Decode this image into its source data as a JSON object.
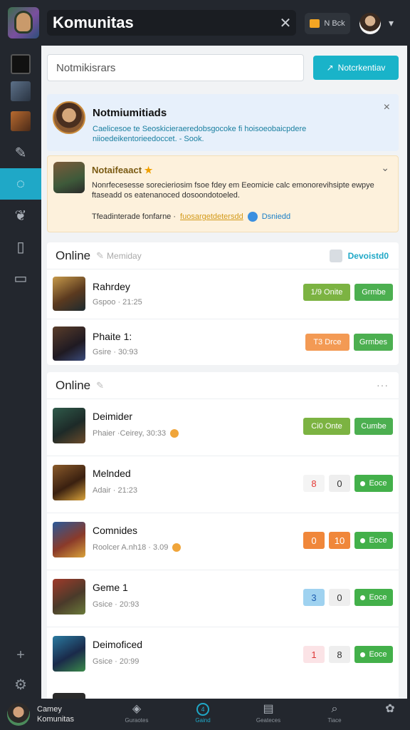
{
  "header": {
    "title": "Komunitas",
    "close_icon": "close-icon",
    "pill_text": "N Bck",
    "caret": "▾"
  },
  "rail": {
    "items": [
      {
        "name": "rail-thumb-1",
        "color": "#2b2b2b"
      },
      {
        "name": "rail-thumb-2",
        "color": "#4a5a6a"
      },
      {
        "name": "rail-thumb-3",
        "color": "#8a4a2a"
      },
      {
        "icon": "puzzle-icon",
        "glyph": "✎"
      },
      {
        "icon": "chat-icon",
        "glyph": "◌",
        "active": true
      },
      {
        "icon": "shield-icon",
        "glyph": "❦"
      },
      {
        "icon": "book-icon",
        "glyph": "▯"
      },
      {
        "icon": "message-icon",
        "glyph": "▭"
      }
    ],
    "bottom_icons": [
      {
        "icon": "add-icon",
        "glyph": "+"
      },
      {
        "icon": "settings-icon",
        "glyph": "⚙"
      }
    ]
  },
  "main": {
    "search_placeholder": "Notmikisrars",
    "primary_button": "Notcrkentiav",
    "notice": {
      "title": "Notmiumitiads",
      "text": "Caelicesoe te Seoskicieraeredobsgocoke fi hoisoeobaicpdere niioedeikentorieedoccet. - Sook.",
      "close": "×"
    },
    "alert": {
      "title": "Notaifeaact",
      "star": "★",
      "text": "Nonrfecesesse sorecieriosim fsoe fdey em Eeomicie calc emonorevihsipte ewpye ftaseadd os eatenanoced dosoondotoeled.",
      "footer_label": "Tfeadinterade fonfarne ·",
      "footer_link": "fuosargetdetersdd",
      "footer_link2": "Dsniedd",
      "caret": "⌄"
    },
    "section1": {
      "title": "Online",
      "subtitle": "Memiday",
      "right_label": "Devoistd0",
      "rows": [
        {
          "name": "Rahrdey",
          "meta": "Gspoo · 21:25",
          "btn1": "1/9 Onite",
          "btn1_style": "olive",
          "btn2": "Grmbe"
        },
        {
          "name": "Phaite 1:",
          "meta": "Gsire · 30:93",
          "btn1": "T3 Drce",
          "btn1_style": "orange",
          "btn2": "Grmbes"
        }
      ]
    },
    "section2": {
      "title": "Online",
      "dots": "···",
      "rows": [
        {
          "name": "Deimider",
          "meta": "Phaier ·Ceirey, 30:33",
          "coin": true,
          "btn1": "Ci0 Onte",
          "btn2": "Cumbe",
          "mode": "buttons"
        },
        {
          "name": "Melnded",
          "meta": "Adair · 21:23",
          "sq1": "8",
          "sq1_color": "#e53935",
          "sq1_bg": "#f4f4f4",
          "sq2": "0",
          "sq2_color": "#333",
          "sq2_bg": "#eeeeee",
          "pill": "Eoce",
          "mode": "squares"
        },
        {
          "name": "Comnides",
          "meta": "Roolcer A.nh18 · 3.09",
          "coin": true,
          "sq1": "0",
          "sq1_color": "#fff",
          "sq1_bg": "#f0873a",
          "sq2": "10",
          "sq2_color": "#fff",
          "sq2_bg": "#f0873a",
          "pill": "Eoce",
          "mode": "squares"
        },
        {
          "name": "Geme 1",
          "meta": "Gsice · 20:93",
          "sq1": "3",
          "sq1_color": "#1f5fb0",
          "sq1_bg": "#9fd2f0",
          "sq2": "0",
          "sq2_color": "#333",
          "sq2_bg": "#eeeeee",
          "pill": "Eoce",
          "mode": "squares"
        },
        {
          "name": "Deimoficed",
          "meta": "Gsice · 20:99",
          "sq1": "1",
          "sq1_color": "#d33",
          "sq1_bg": "#fbe3e6",
          "sq2": "8",
          "sq2_color": "#333",
          "sq2_bg": "#eeeeee",
          "pill": "Eoce",
          "mode": "squares"
        }
      ]
    }
  },
  "bottombar": {
    "user_line1": "Camey",
    "user_line2": "Komunitas",
    "tabs": [
      {
        "icon": "compass-icon",
        "glyph": "◈",
        "label": "Guraotes"
      },
      {
        "icon": "home-icon",
        "glyph": "4",
        "label": "Gaind",
        "active": true
      },
      {
        "icon": "store-icon",
        "glyph": "▤",
        "label": "Geateces"
      },
      {
        "icon": "search-icon",
        "glyph": "⌕",
        "label": "Tiace"
      },
      {
        "icon": "gear-icon",
        "glyph": "✿",
        "label": ""
      }
    ]
  }
}
